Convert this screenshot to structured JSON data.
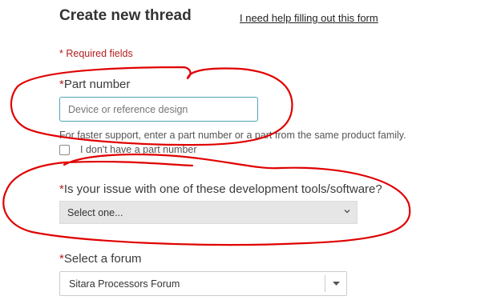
{
  "header": {
    "title": "Create new thread",
    "help_link": "I need help filling out this form"
  },
  "form": {
    "required_note": "* Required fields",
    "part_number": {
      "label": "Part number",
      "placeholder": "Device or reference design",
      "hint": "For faster support, enter a part number or a part from the same product family.",
      "no_part_checkbox_label": "I don't have a part number",
      "no_part_checked": false
    },
    "dev_tools": {
      "label": "Is your issue with one of these development tools/software?",
      "selected": "Select one..."
    },
    "forum": {
      "label": "Select a forum",
      "selected": "Sitara Processors Forum"
    },
    "required_marker": "*"
  },
  "colors": {
    "required_red": "#b21e1e",
    "annotation_red": "#e00000",
    "input_focus_border": "#4fa7b6",
    "select_bg": "#e6e6e6"
  },
  "icons": {
    "dev_tools_select": "chevron-down-icon",
    "forum_select": "caret-down-icon"
  }
}
